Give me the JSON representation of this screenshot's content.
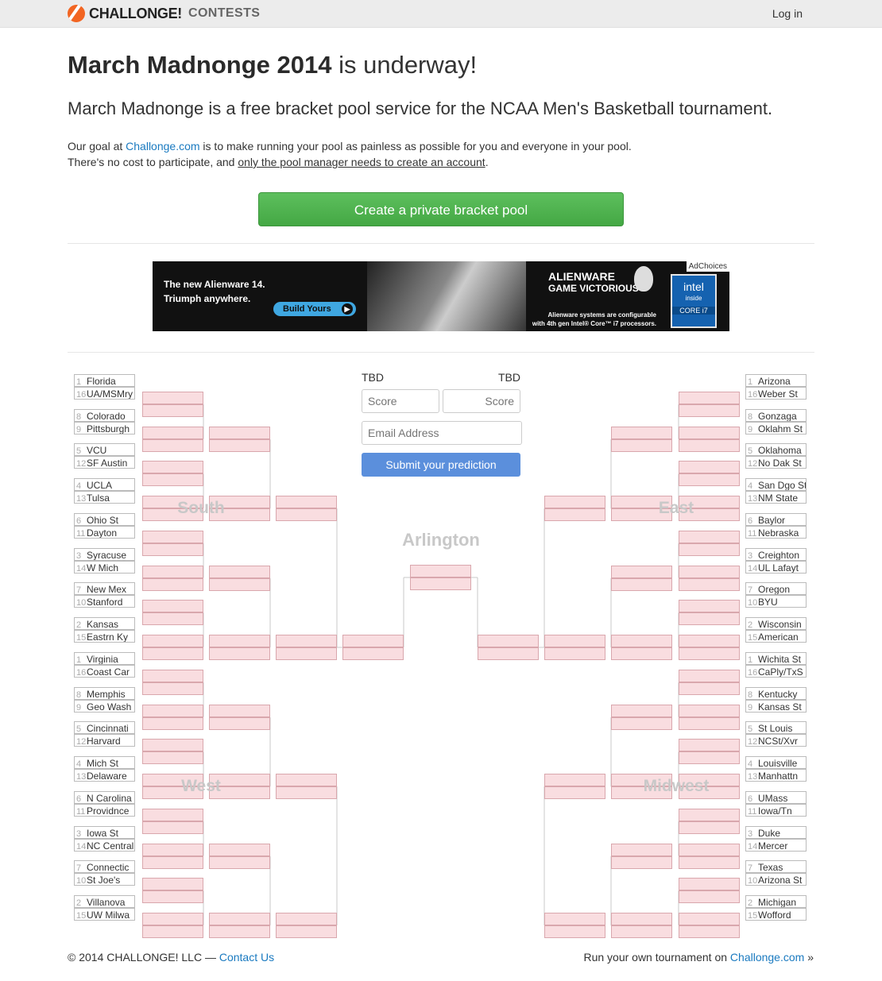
{
  "header": {
    "brand": "CHALLONGE!",
    "product": "CONTESTS",
    "login": "Log in"
  },
  "hero": {
    "title_bold": "March Madnonge 2014",
    "title_rest": " is underway!",
    "lead": "March Madnonge is a free bracket pool service for the NCAA Men's Basketball tournament.",
    "p1_pre": "Our goal at ",
    "p1_link": "Challonge.com",
    "p1_post": " is to make running your pool as painless as possible for you and everyone in your pool.",
    "p2_pre": "There's no cost to participate, and ",
    "p2_link": "only the pool manager needs to create an account",
    "p2_post": ".",
    "cta": "Create a private bracket pool"
  },
  "ad": {
    "headline1": "The new Alienware 14.",
    "headline2": "Triumph anywhere.",
    "button": "Build Yours",
    "brand1": "ALIENWARE",
    "brand2": "GAME VICTORIOUS",
    "fine1": "Alienware systems are configurable",
    "fine2": "with 4th gen Intel® Core™ i7 processors.",
    "adchoices": "AdChoices",
    "intel1": "intel",
    "intel2": "inside",
    "intel3": "CORE i7"
  },
  "final": {
    "team_a": "TBD",
    "team_b": "TBD",
    "score_placeholder": "Score",
    "email_placeholder": "Email Address",
    "submit": "Submit your prediction",
    "location": "Arlington"
  },
  "regions": {
    "south": {
      "name": "South",
      "teams": [
        [
          "1",
          "Florida"
        ],
        [
          "16",
          "UA/MSMry"
        ],
        [
          "8",
          "Colorado"
        ],
        [
          "9",
          "Pittsburgh"
        ],
        [
          "5",
          "VCU"
        ],
        [
          "12",
          "SF Austin"
        ],
        [
          "4",
          "UCLA"
        ],
        [
          "13",
          "Tulsa"
        ],
        [
          "6",
          "Ohio St"
        ],
        [
          "11",
          "Dayton"
        ],
        [
          "3",
          "Syracuse"
        ],
        [
          "14",
          "W Mich"
        ],
        [
          "7",
          "New Mex"
        ],
        [
          "10",
          "Stanford"
        ],
        [
          "2",
          "Kansas"
        ],
        [
          "15",
          "Eastrn Ky"
        ]
      ]
    },
    "west": {
      "name": "West",
      "teams": [
        [
          "1",
          "Virginia"
        ],
        [
          "16",
          "Coast Car"
        ],
        [
          "8",
          "Memphis"
        ],
        [
          "9",
          "Geo Wash"
        ],
        [
          "5",
          "Cincinnati"
        ],
        [
          "12",
          "Harvard"
        ],
        [
          "4",
          "Mich St"
        ],
        [
          "13",
          "Delaware"
        ],
        [
          "6",
          "N Carolina"
        ],
        [
          "11",
          "Providnce"
        ],
        [
          "3",
          "Iowa St"
        ],
        [
          "14",
          "NC Central"
        ],
        [
          "7",
          "Connectic"
        ],
        [
          "10",
          "St Joe's"
        ],
        [
          "2",
          "Villanova"
        ],
        [
          "15",
          "UW Milwa"
        ]
      ]
    },
    "east": {
      "name": "East",
      "teams": [
        [
          "1",
          "Arizona"
        ],
        [
          "16",
          "Weber St"
        ],
        [
          "8",
          "Gonzaga"
        ],
        [
          "9",
          "Oklahm St"
        ],
        [
          "5",
          "Oklahoma"
        ],
        [
          "12",
          "No Dak St"
        ],
        [
          "4",
          "San Dgo St"
        ],
        [
          "13",
          "NM State"
        ],
        [
          "6",
          "Baylor"
        ],
        [
          "11",
          "Nebraska"
        ],
        [
          "3",
          "Creighton"
        ],
        [
          "14",
          "UL Lafayt"
        ],
        [
          "7",
          "Oregon"
        ],
        [
          "10",
          "BYU"
        ],
        [
          "2",
          "Wisconsin"
        ],
        [
          "15",
          "American"
        ]
      ]
    },
    "midwest": {
      "name": "Midwest",
      "teams": [
        [
          "1",
          "Wichita St"
        ],
        [
          "16",
          "CaPly/TxS"
        ],
        [
          "8",
          "Kentucky"
        ],
        [
          "9",
          "Kansas St"
        ],
        [
          "5",
          "St Louis"
        ],
        [
          "12",
          "NCSt/Xvr"
        ],
        [
          "4",
          "Louisville"
        ],
        [
          "13",
          "Manhattn"
        ],
        [
          "6",
          "UMass"
        ],
        [
          "11",
          "Iowa/Tn"
        ],
        [
          "3",
          "Duke"
        ],
        [
          "14",
          "Mercer"
        ],
        [
          "7",
          "Texas"
        ],
        [
          "10",
          "Arizona St"
        ],
        [
          "2",
          "Michigan"
        ],
        [
          "15",
          "Wofford"
        ]
      ]
    }
  },
  "footer": {
    "copyright": "© 2014 CHALLONGE! LLC — ",
    "contact": "Contact Us",
    "run_pre": "Run your own tournament on ",
    "run_link": "Challonge.com",
    "run_post": " »"
  }
}
